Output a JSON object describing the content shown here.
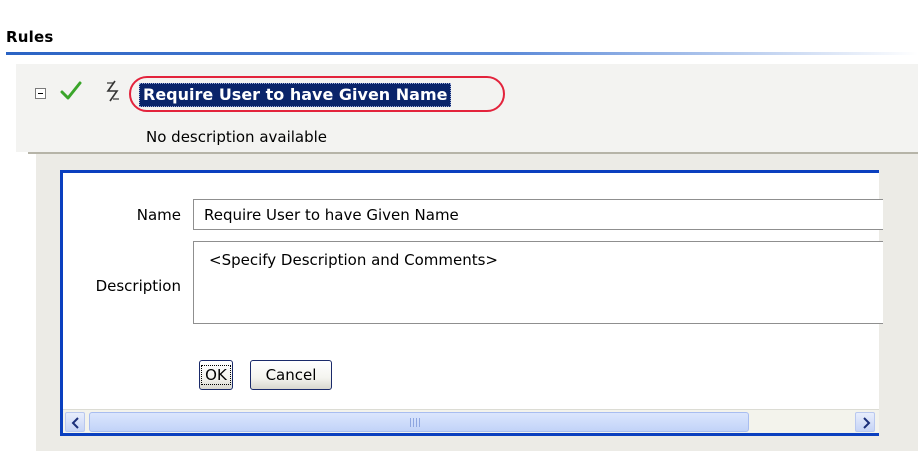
{
  "section": {
    "title": "Rules"
  },
  "rule": {
    "name": "Require User to have Given Name",
    "description": "No description available",
    "icons": {
      "collapse": "collapse-icon",
      "enabled": "check-icon",
      "toggle": "toggle-icon"
    },
    "colors": {
      "selection": "#0a246a",
      "highlight_ring": "#e3233c",
      "enabled_check": "#3aa52a"
    }
  },
  "editor": {
    "name_label": "Name",
    "name_value": "Require User to have Given Name",
    "description_label": "Description",
    "description_value": "<Specify Description and Comments>",
    "ok_label": "OK",
    "cancel_label": "Cancel",
    "border_color": "#0a3fbf"
  },
  "scrollbar": {
    "left_icon": "arrow-left-icon",
    "right_icon": "arrow-right-icon",
    "thumb_grip_icon": "grip-icon"
  }
}
